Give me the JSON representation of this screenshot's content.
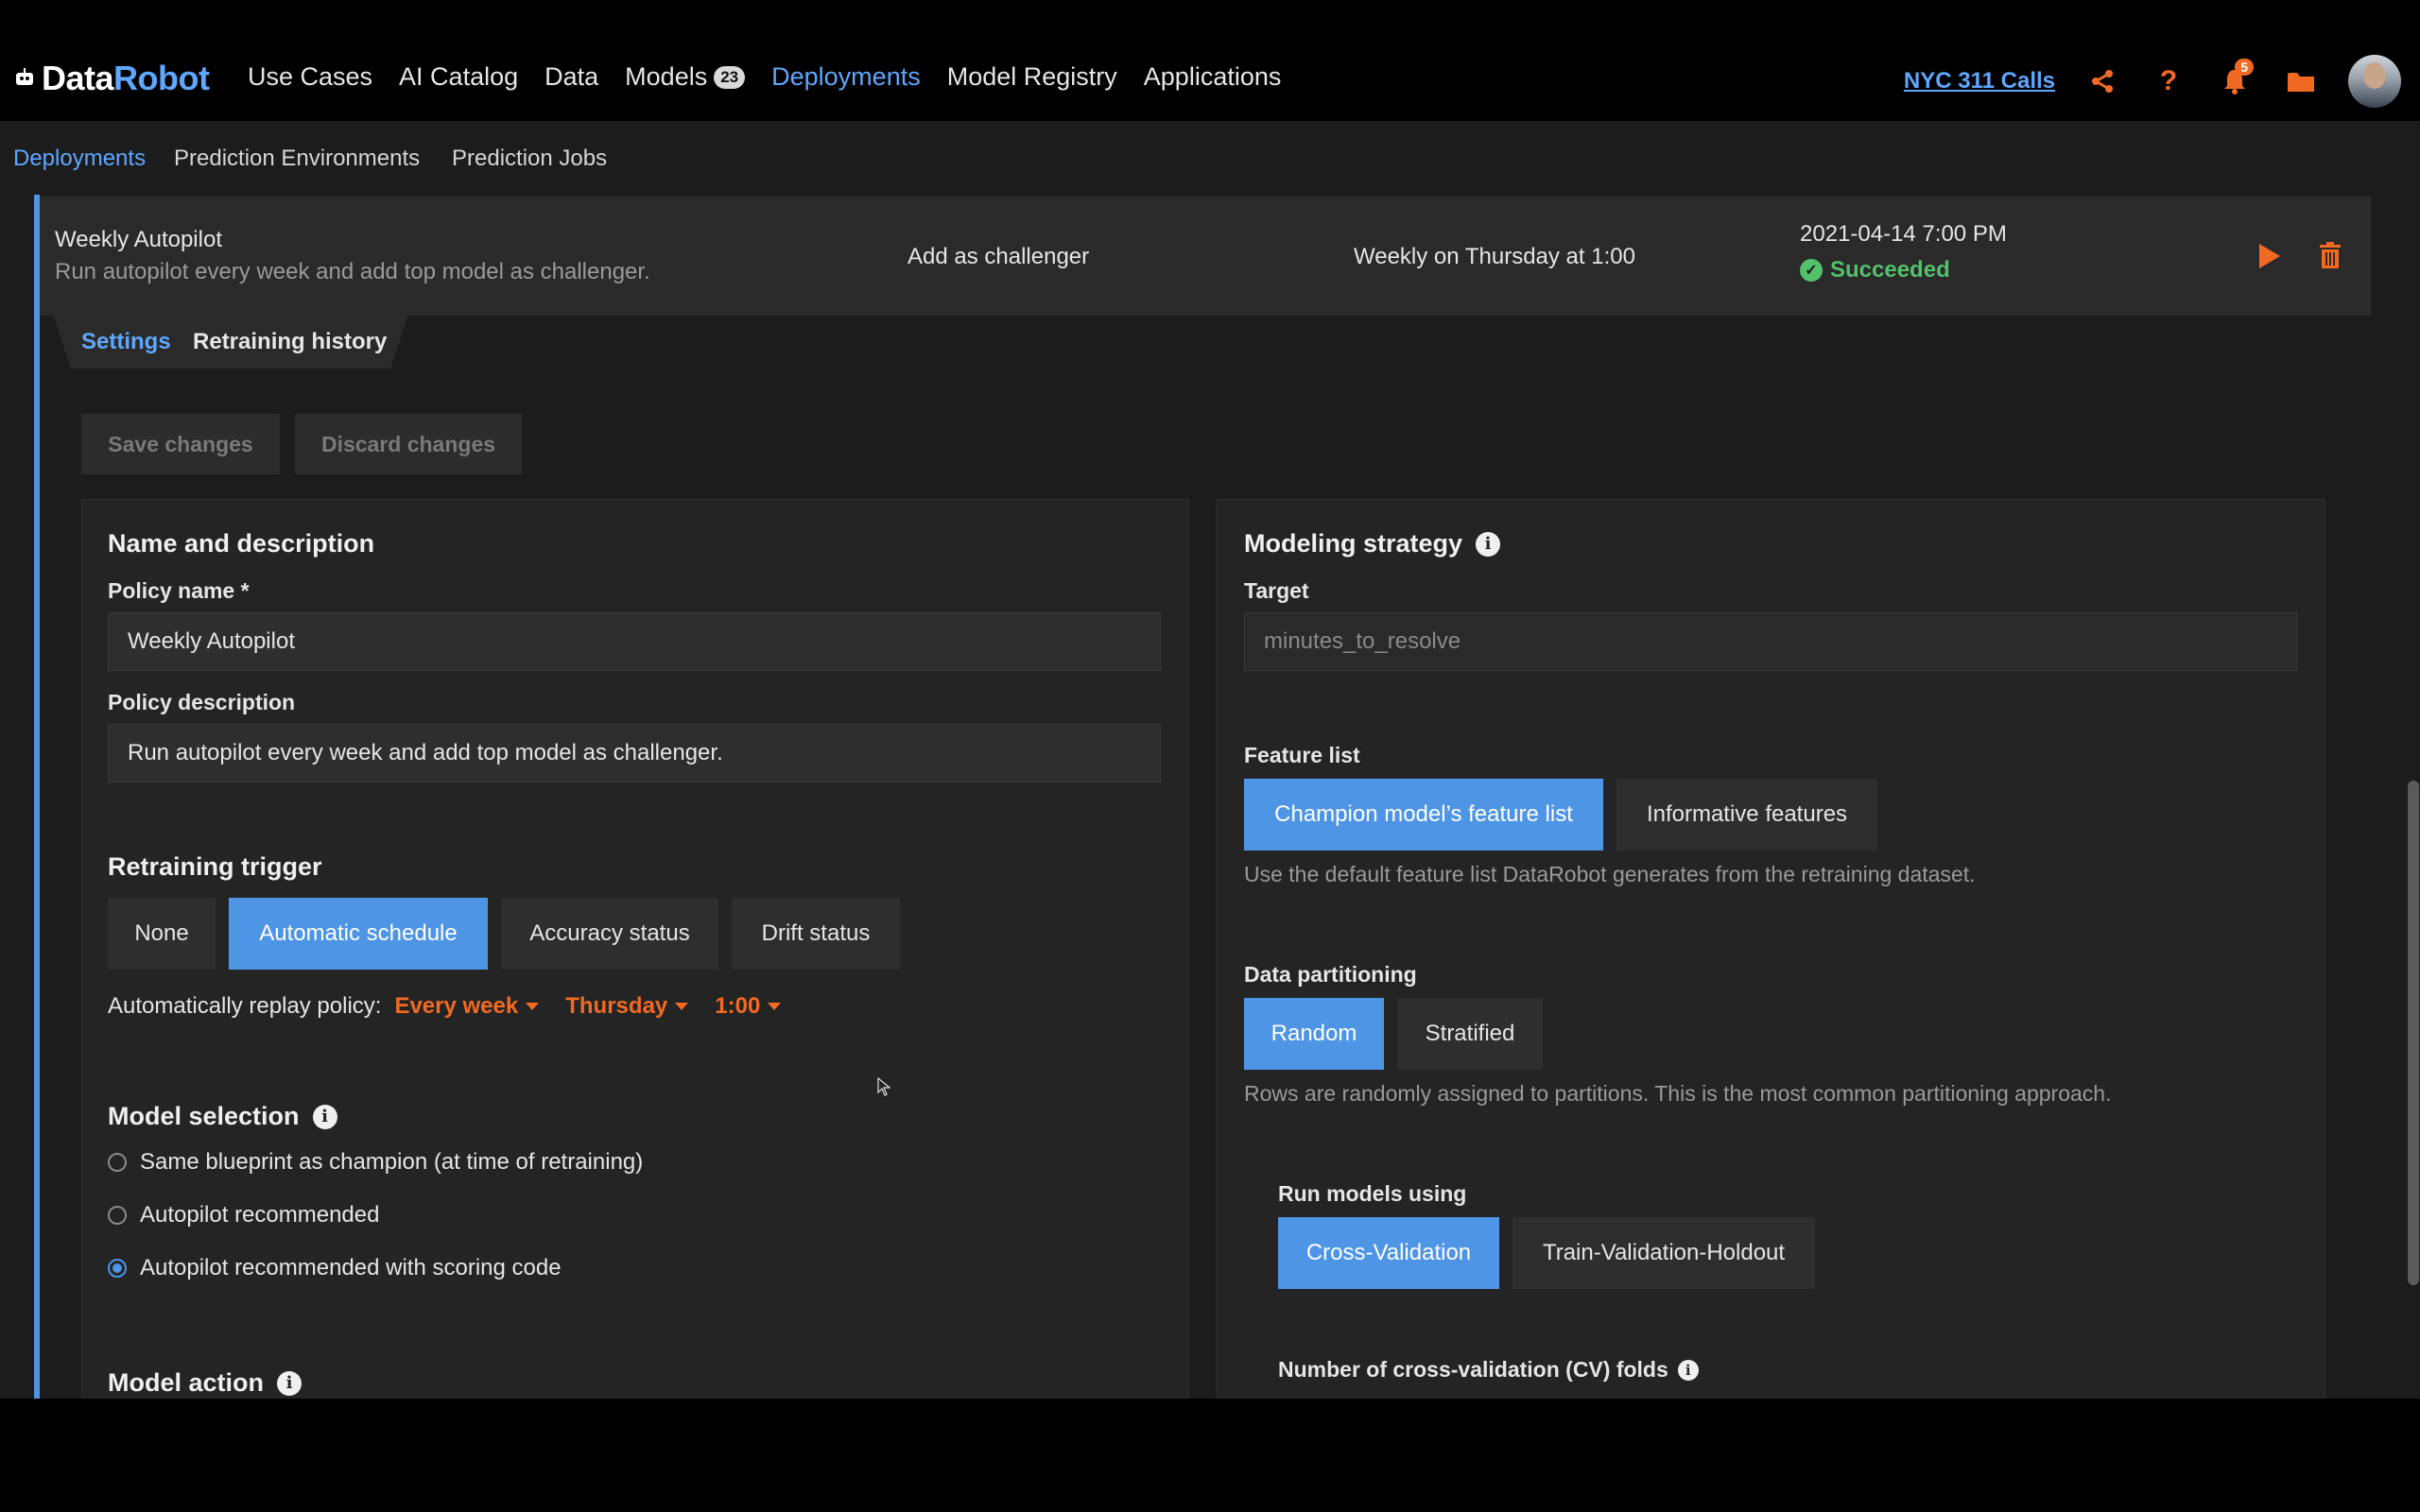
{
  "brand": {
    "part1": "Data",
    "part2": "Robot"
  },
  "nav": {
    "items": [
      {
        "label": "Use Cases"
      },
      {
        "label": "AI Catalog"
      },
      {
        "label": "Data"
      },
      {
        "label": "Models",
        "badge": "23"
      },
      {
        "label": "Deployments"
      },
      {
        "label": "Model Registry"
      },
      {
        "label": "Applications"
      }
    ],
    "project": "NYC 311 Calls",
    "notifications": "5"
  },
  "subnav": {
    "items": [
      {
        "label": "Deployments"
      },
      {
        "label": "Prediction Environments"
      },
      {
        "label": "Prediction Jobs"
      }
    ]
  },
  "policy": {
    "title": "Weekly Autopilot",
    "description": "Run autopilot every week and add top model as challenger.",
    "action": "Add as challenger",
    "schedule": "Weekly on Thursday at 1:00",
    "date": "2021-04-14 7:00 PM",
    "status": "Succeeded"
  },
  "tabs": {
    "settings": "Settings",
    "history": "Retraining history"
  },
  "buttons": {
    "save": "Save changes",
    "discard": "Discard changes"
  },
  "left": {
    "name_section": "Name and description",
    "policy_name_label": "Policy name *",
    "policy_name_value": "Weekly Autopilot",
    "policy_desc_label": "Policy description",
    "policy_desc_value": "Run autopilot every week and add top model as challenger.",
    "trigger_title": "Retraining trigger",
    "triggers": [
      "None",
      "Automatic schedule",
      "Accuracy status",
      "Drift status"
    ],
    "replay_label": "Automatically replay policy:",
    "replay_frequency": "Every week",
    "replay_day": "Thursday",
    "replay_time": "1:00",
    "model_selection_title": "Model selection",
    "model_options": [
      "Same blueprint as champion (at time of retraining)",
      "Autopilot recommended",
      "Autopilot recommended with scoring code"
    ],
    "model_action_title": "Model action"
  },
  "right": {
    "strategy_title": "Modeling strategy",
    "target_label": "Target",
    "target_value": "minutes_to_resolve",
    "feature_list_label": "Feature list",
    "feature_options": [
      "Champion model’s feature list",
      "Informative features"
    ],
    "feature_help": "Use the default feature list DataRobot generates from the retraining dataset.",
    "partition_label": "Data partitioning",
    "partition_options": [
      "Random",
      "Stratified"
    ],
    "partition_help": "Rows are randomly assigned to partitions. This is the most common partitioning approach.",
    "run_models_label": "Run models using",
    "run_options": [
      "Cross-Validation",
      "Train-Validation-Holdout"
    ],
    "cv_folds_label": "Number of cross-validation (CV) folds"
  },
  "colors": {
    "accent": "#4e95e6",
    "orange": "#f26a21",
    "success": "#53c06b"
  }
}
